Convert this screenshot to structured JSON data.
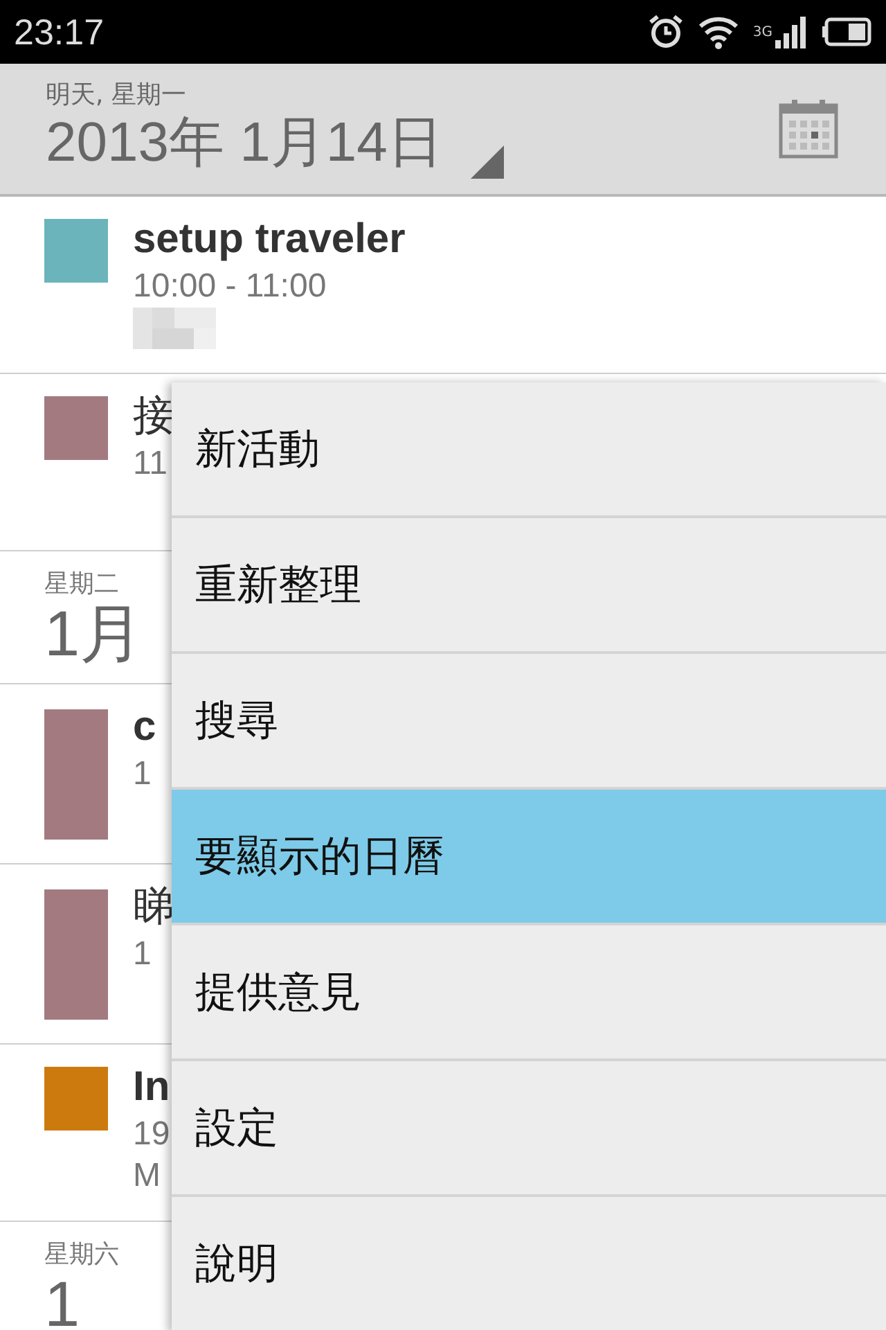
{
  "status_bar": {
    "time": "23:17",
    "network": "3G"
  },
  "header": {
    "subtitle": "明天, 星期一",
    "date": "2013年 1月14日"
  },
  "agenda": [
    {
      "kind": "event",
      "color": "#6cb4bc",
      "tall": false,
      "bold": true,
      "title": "setup traveler",
      "lines": [
        "10:00 - 11:00"
      ],
      "redacted": true
    },
    {
      "kind": "event",
      "color": "#a27a80",
      "tall": false,
      "bold": false,
      "title": "接",
      "lines": [
        "11"
      ]
    },
    {
      "kind": "day",
      "weekday": "星期二",
      "date": "1月"
    },
    {
      "kind": "event",
      "color": "#a27a80",
      "tall": true,
      "bold": true,
      "title": "c",
      "lines": [
        "1"
      ]
    },
    {
      "kind": "event",
      "color": "#a27a80",
      "tall": true,
      "bold": false,
      "title": "睇",
      "lines": [
        "1"
      ]
    },
    {
      "kind": "event",
      "color": "#cc7a0e",
      "tall": false,
      "bold": true,
      "title": "In",
      "lines": [
        "19",
        "M"
      ]
    },
    {
      "kind": "day",
      "weekday": "星期六",
      "date": "1"
    }
  ],
  "menu": [
    {
      "label": "新活動",
      "selected": false
    },
    {
      "label": "重新整理",
      "selected": false
    },
    {
      "label": "搜尋",
      "selected": false
    },
    {
      "label": "要顯示的日曆",
      "selected": true
    },
    {
      "label": "提供意見",
      "selected": false
    },
    {
      "label": "設定",
      "selected": false
    },
    {
      "label": "說明",
      "selected": false
    }
  ]
}
